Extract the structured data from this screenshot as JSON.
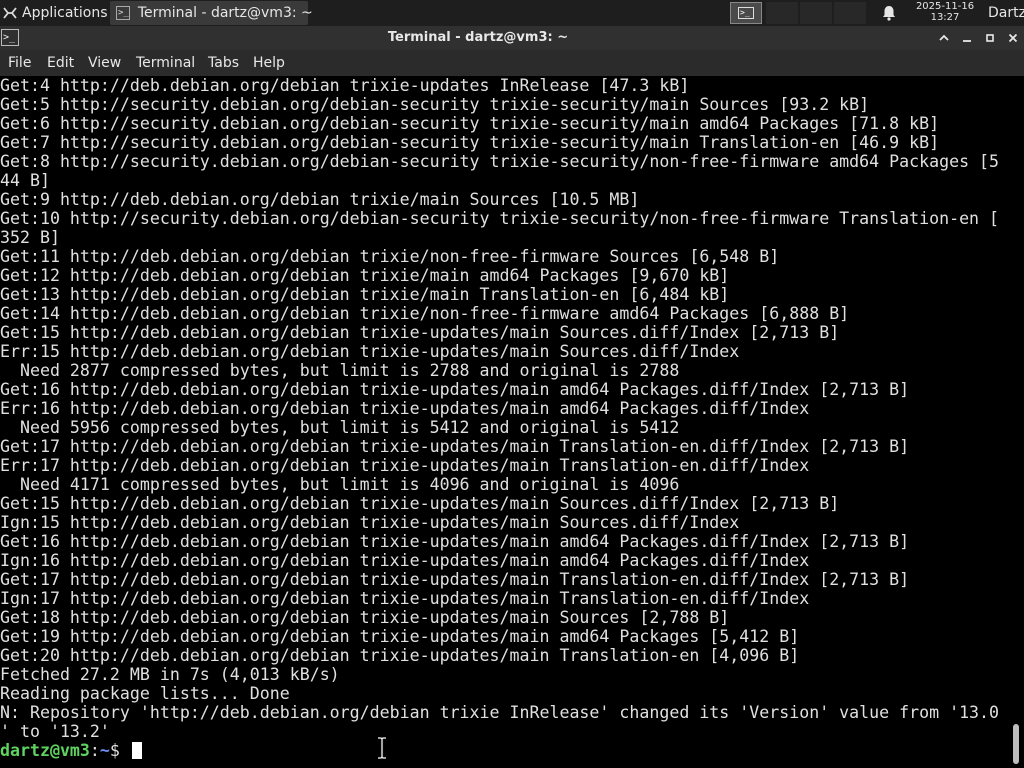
{
  "panel": {
    "applications_label": "Applications",
    "task_title": "Terminal - dartz@vm3: ~",
    "clock_date": "2025-11-16",
    "clock_time": "13:27",
    "user_name": "Dartz"
  },
  "window": {
    "title": "Terminal - dartz@vm3: ~"
  },
  "menu": {
    "file": "File",
    "edit": "Edit",
    "view": "View",
    "terminal": "Terminal",
    "tabs": "Tabs",
    "help": "Help"
  },
  "terminal": {
    "lines": [
      "Get:4 http://deb.debian.org/debian trixie-updates InRelease [47.3 kB]",
      "Get:5 http://security.debian.org/debian-security trixie-security/main Sources [93.2 kB]",
      "Get:6 http://security.debian.org/debian-security trixie-security/main amd64 Packages [71.8 kB]",
      "Get:7 http://security.debian.org/debian-security trixie-security/main Translation-en [46.9 kB]",
      "Get:8 http://security.debian.org/debian-security trixie-security/non-free-firmware amd64 Packages [5",
      "44 B]",
      "Get:9 http://deb.debian.org/debian trixie/main Sources [10.5 MB]",
      "Get:10 http://security.debian.org/debian-security trixie-security/non-free-firmware Translation-en [",
      "352 B]",
      "Get:11 http://deb.debian.org/debian trixie/non-free-firmware Sources [6,548 B]",
      "Get:12 http://deb.debian.org/debian trixie/main amd64 Packages [9,670 kB]",
      "Get:13 http://deb.debian.org/debian trixie/main Translation-en [6,484 kB]",
      "Get:14 http://deb.debian.org/debian trixie/non-free-firmware amd64 Packages [6,888 B]",
      "Get:15 http://deb.debian.org/debian trixie-updates/main Sources.diff/Index [2,713 B]",
      "Err:15 http://deb.debian.org/debian trixie-updates/main Sources.diff/Index",
      "  Need 2877 compressed bytes, but limit is 2788 and original is 2788",
      "Get:16 http://deb.debian.org/debian trixie-updates/main amd64 Packages.diff/Index [2,713 B]",
      "Err:16 http://deb.debian.org/debian trixie-updates/main amd64 Packages.diff/Index",
      "  Need 5956 compressed bytes, but limit is 5412 and original is 5412",
      "Get:17 http://deb.debian.org/debian trixie-updates/main Translation-en.diff/Index [2,713 B]",
      "Err:17 http://deb.debian.org/debian trixie-updates/main Translation-en.diff/Index",
      "  Need 4171 compressed bytes, but limit is 4096 and original is 4096",
      "Get:15 http://deb.debian.org/debian trixie-updates/main Sources.diff/Index [2,713 B]",
      "Ign:15 http://deb.debian.org/debian trixie-updates/main Sources.diff/Index",
      "Get:16 http://deb.debian.org/debian trixie-updates/main amd64 Packages.diff/Index [2,713 B]",
      "Ign:16 http://deb.debian.org/debian trixie-updates/main amd64 Packages.diff/Index",
      "Get:17 http://deb.debian.org/debian trixie-updates/main Translation-en.diff/Index [2,713 B]",
      "Ign:17 http://deb.debian.org/debian trixie-updates/main Translation-en.diff/Index",
      "Get:18 http://deb.debian.org/debian trixie-updates/main Sources [2,788 B]",
      "Get:19 http://deb.debian.org/debian trixie-updates/main amd64 Packages [5,412 B]",
      "Get:20 http://deb.debian.org/debian trixie-updates/main Translation-en [4,096 B]",
      "Fetched 27.2 MB in 7s (4,013 kB/s)",
      "Reading package lists... Done",
      "N: Repository 'http://deb.debian.org/debian trixie InRelease' changed its 'Version' value from '13.0",
      "' to '13.2'"
    ],
    "prompt_user": "dartz@vm3",
    "prompt_sep": ":",
    "prompt_path": "~",
    "prompt_symbol": "$ "
  },
  "colors": {
    "prompt_user": "#5fd35f",
    "prompt_path": "#6a8ff0",
    "terminal_bg": "#000000",
    "terminal_fg": "#e0e0e0"
  }
}
